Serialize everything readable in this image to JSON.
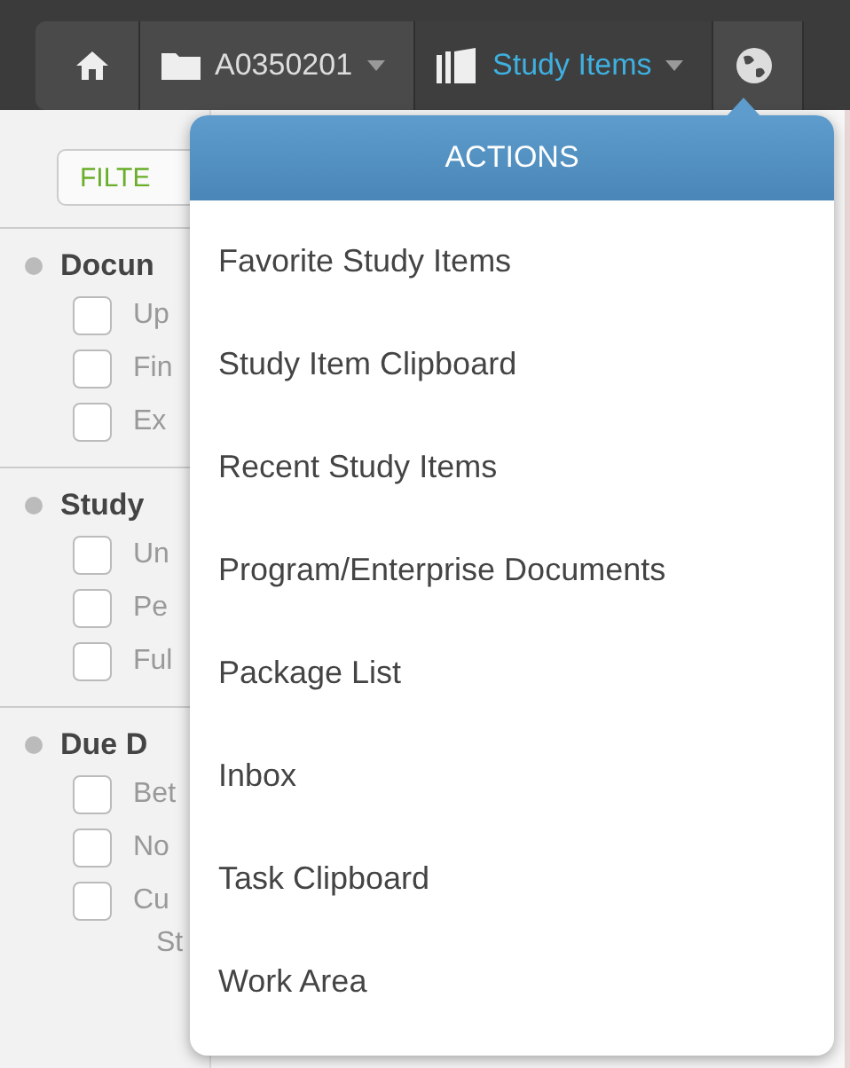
{
  "breadcrumbs": [
    {
      "kind": "home"
    },
    {
      "kind": "folder",
      "label": "A0350201",
      "dropdown": true,
      "selected": false
    },
    {
      "kind": "books",
      "label": "Study Items",
      "dropdown": true,
      "selected": true
    },
    {
      "kind": "globe"
    }
  ],
  "filter_button": "FILTE",
  "filter_groups": [
    {
      "title": "Docun",
      "options": [
        {
          "label": "Up",
          "checked": false
        },
        {
          "label": "Fin",
          "checked": false
        },
        {
          "label": "Ex",
          "checked": false
        }
      ]
    },
    {
      "title": "Study",
      "options": [
        {
          "label": "Un",
          "checked": false
        },
        {
          "label": "Pe",
          "checked": false
        },
        {
          "label": "Ful",
          "checked": false
        }
      ]
    },
    {
      "title": "Due D",
      "options": [
        {
          "label": "Bet",
          "checked": false
        },
        {
          "label": "No",
          "checked": false
        },
        {
          "label": "Cu",
          "checked": false
        }
      ],
      "footer": "St"
    }
  ],
  "menu": {
    "title": "ACTIONS",
    "items": [
      "Favorite Study Items",
      "Study Item Clipboard",
      "Recent Study Items",
      "Program/Enterprise Documents",
      "Package List",
      "Inbox",
      "Task Clipboard",
      "Work Area"
    ]
  }
}
